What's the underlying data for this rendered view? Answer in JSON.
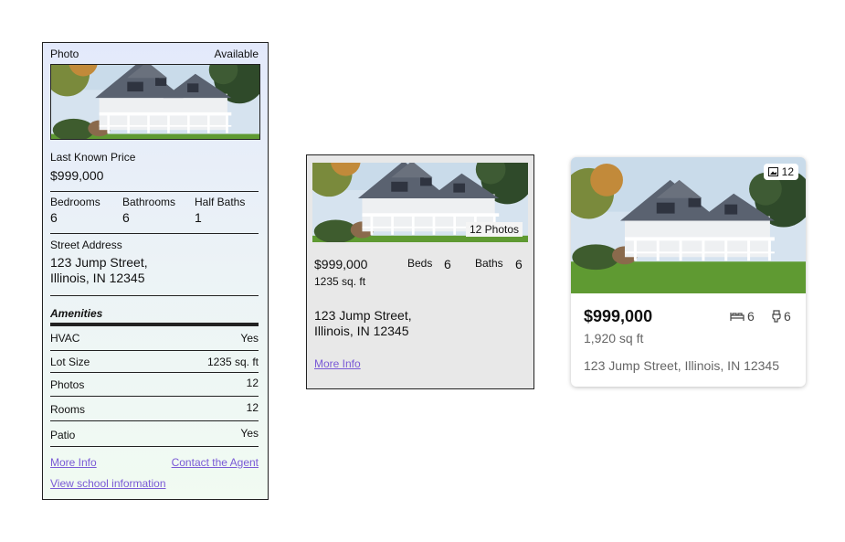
{
  "card1": {
    "photo_label": "Photo",
    "photo_status": "Available",
    "price_label": "Last Known Price",
    "price": "$999,000",
    "bedrooms_label": "Bedrooms",
    "bedrooms": "6",
    "bathrooms_label": "Bathrooms",
    "bathrooms": "6",
    "half_baths_label": "Half Baths",
    "half_baths": "1",
    "address_label": "Street Address",
    "address_line1": "123 Jump Street,",
    "address_line2": "Illinois, IN 12345",
    "amenities_heading": "Amenities",
    "amenities": [
      {
        "label": "HVAC",
        "value": "Yes"
      },
      {
        "label": "Lot Size",
        "value": "1235 sq. ft"
      },
      {
        "label": "Photos",
        "value": "12"
      },
      {
        "label": "Rooms",
        "value": "12"
      },
      {
        "label": "Patio",
        "value": "Yes"
      }
    ],
    "more_info": "More Info",
    "contact_agent": "Contact the Agent",
    "school_info": "View school information"
  },
  "card2": {
    "photos_badge": "12 Photos",
    "price": "$999,000",
    "sqft": "1235 sq. ft",
    "beds_label": "Beds",
    "beds": "6",
    "baths_label": "Baths",
    "baths": "6",
    "address_line1": "123 Jump Street,",
    "address_line2": "Illinois, IN 12345",
    "more_info": "More Info"
  },
  "card3": {
    "photo_count": "12",
    "price": "$999,000",
    "sqft": "1,920 sq ft",
    "beds": "6",
    "baths": "6",
    "address": "123 Jump Street, Illinois, IN 12345"
  },
  "icons": [
    "image-icon",
    "bed-icon",
    "toilet-icon"
  ],
  "colors": {
    "link": "#7a5ad6",
    "card2_bg": "#e8e8e8",
    "text_secondary": "#666666"
  }
}
